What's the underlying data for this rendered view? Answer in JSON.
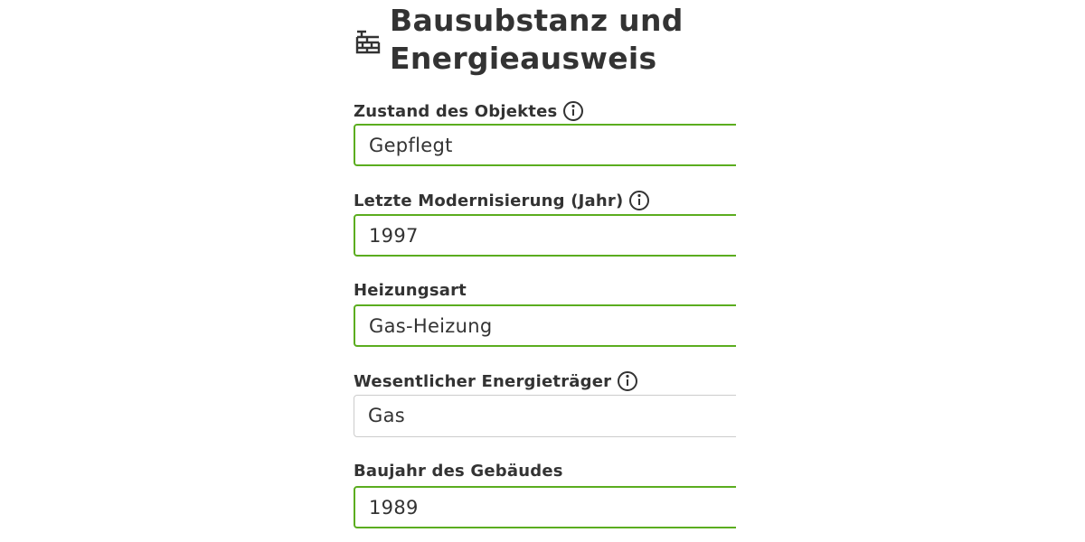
{
  "header": {
    "title_line1": "Bausubstanz und",
    "title_line2": "Energieausweis",
    "icon": "brick-wall-icon"
  },
  "fields": [
    {
      "label": "Zustand des Objektes",
      "type": "select",
      "value": "Gepflegt",
      "info": true
    },
    {
      "label": "Letzte Modernisierung (Jahr)",
      "type": "input",
      "value": "1997",
      "info": true
    },
    {
      "label": "Heizungsart",
      "type": "select",
      "value": "Gas-Heizung",
      "info": false
    },
    {
      "label": "Wesentlicher Energieträger",
      "type": "select",
      "value": "Gas",
      "info": true
    },
    {
      "label": "Baujahr des Gebäudes",
      "type": "input",
      "value": "1989",
      "info": false
    }
  ],
  "colors": {
    "accent": "#5bad1f",
    "text": "#333333",
    "background": "#ffffff"
  }
}
